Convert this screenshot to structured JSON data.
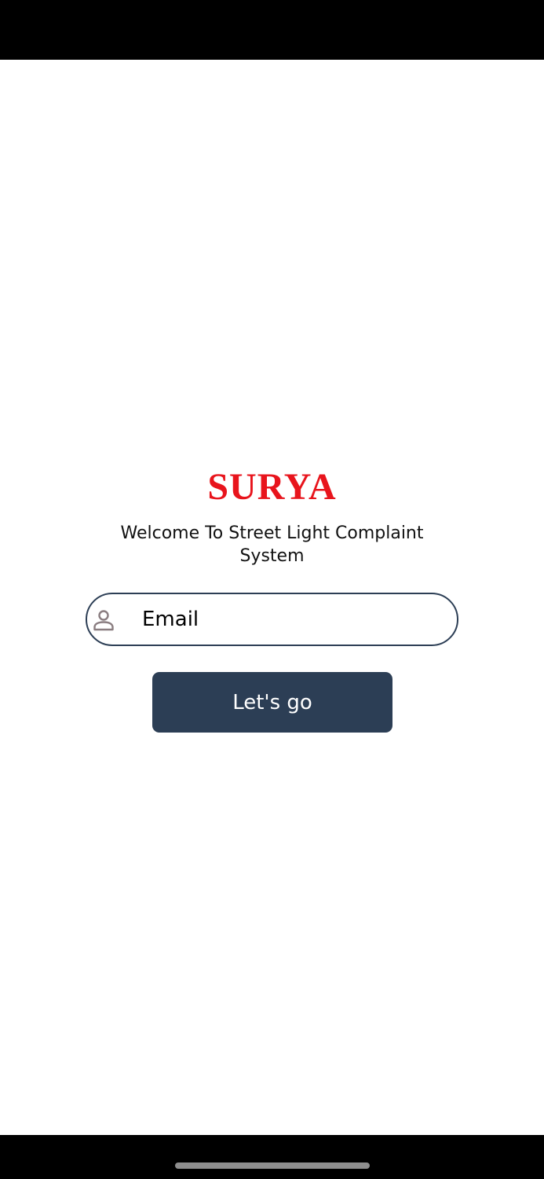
{
  "app": {
    "logo_text": "SURYA",
    "welcome_text": "Welcome To Street Light Complaint System"
  },
  "login": {
    "email_placeholder": "Email",
    "email_value": "",
    "user_icon": "user-icon",
    "submit_label": "Let's go"
  },
  "colors": {
    "brand_red": "#e8141c",
    "button_bg": "#2c3e55",
    "button_text": "#ffffff",
    "icon_gray": "#8a7d80"
  }
}
